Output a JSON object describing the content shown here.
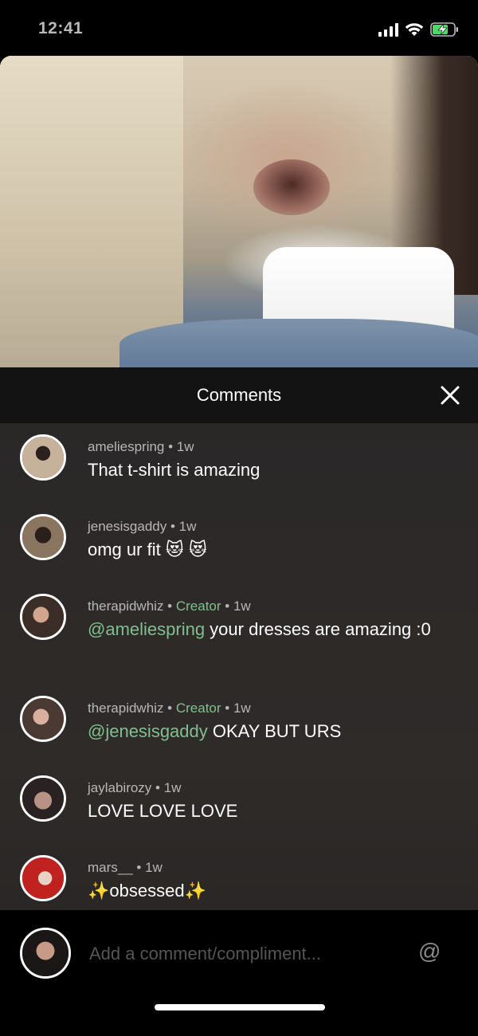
{
  "status_bar": {
    "time": "12:41"
  },
  "sheet": {
    "title": "Comments"
  },
  "comments": [
    {
      "username": "ameliespring",
      "creator": "",
      "time": "1w",
      "mention": "",
      "text": "That t-shirt is amazing",
      "avatar_color": "#b7a48a"
    },
    {
      "username": "jenesisgaddy",
      "creator": "",
      "time": "1w",
      "mention": "",
      "text": "omg ur fit 😻 😻",
      "avatar_color": "#6e5b48"
    },
    {
      "username": "therapidwhiz",
      "creator": "Creator",
      "time": "1w",
      "mention": "@ameliespring",
      "text": " your dresses are amazing :0",
      "avatar_color": "#8a6e5a"
    },
    {
      "username": "therapidwhiz",
      "creator": "Creator",
      "time": "1w",
      "mention": "@jenesisgaddy",
      "text": " OKAY BUT URS",
      "avatar_color": "#9a7a66"
    },
    {
      "username": "jaylabirozy",
      "creator": "",
      "time": "1w",
      "mention": "",
      "text": "LOVE LOVE LOVE",
      "avatar_color": "#3c3030"
    },
    {
      "username": "mars__",
      "creator": "",
      "time": "1w",
      "mention": "",
      "text": "✨obsessed✨",
      "avatar_color": "#c0231f"
    }
  ],
  "input": {
    "placeholder": "Add a comment/compliment...",
    "at_symbol": "@"
  },
  "colors": {
    "creator_green": "#7fc08e",
    "sheet_bg": "#2c2928",
    "header_bg": "#141313"
  }
}
